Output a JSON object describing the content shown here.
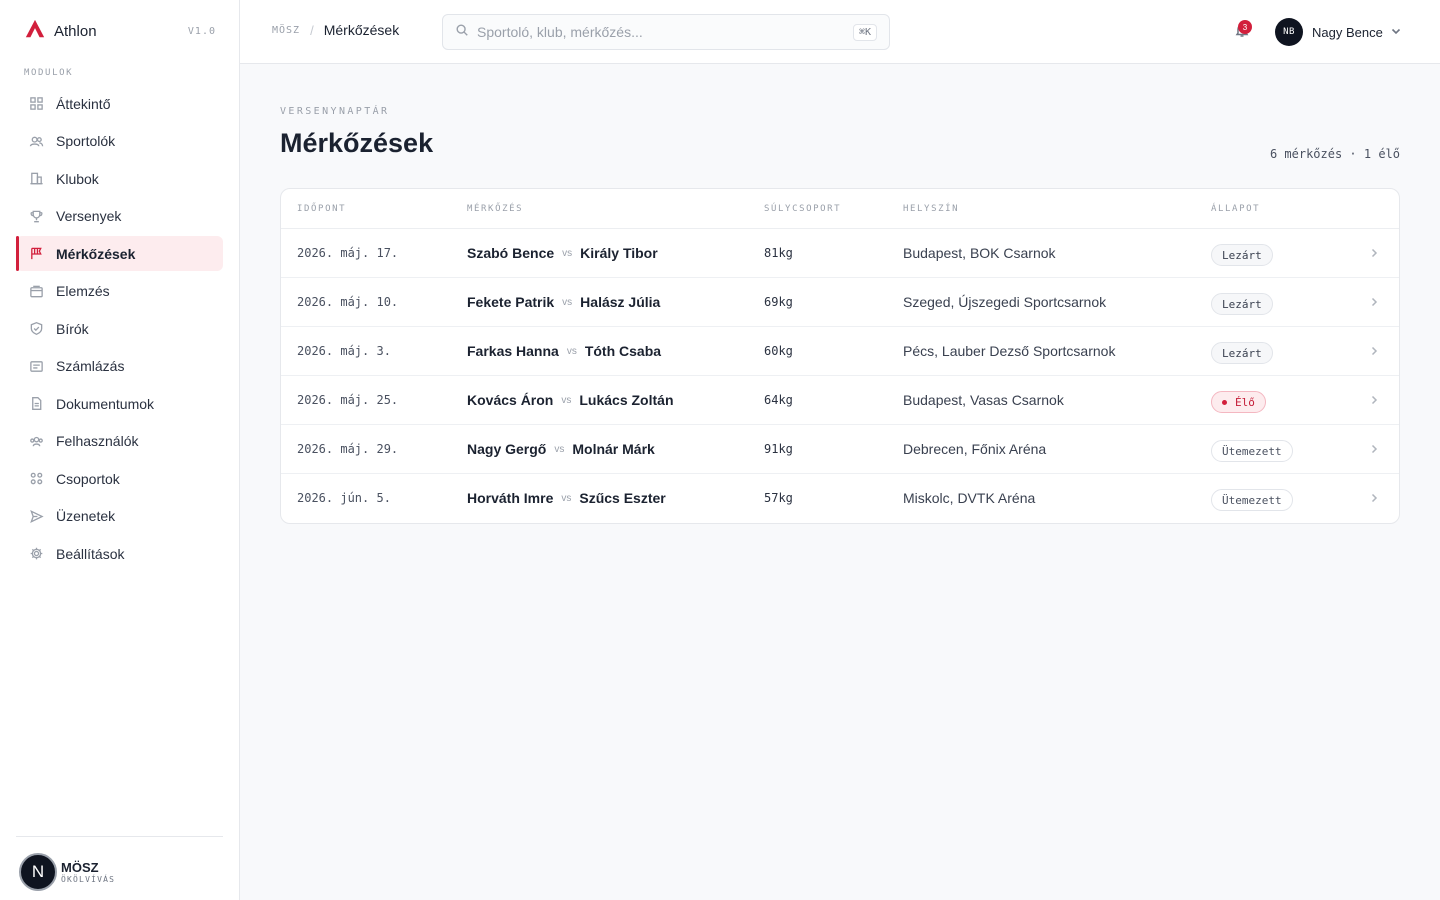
{
  "brand": {
    "name": "Athlon",
    "version": "V1.0"
  },
  "sidebar": {
    "section_label": "MODULOK",
    "items": [
      {
        "label": "Áttekintő",
        "icon": "grid-icon"
      },
      {
        "label": "Sportolók",
        "icon": "users-icon"
      },
      {
        "label": "Klubok",
        "icon": "building-icon"
      },
      {
        "label": "Versenyek",
        "icon": "trophy-icon"
      },
      {
        "label": "Mérkőzések",
        "icon": "flag-icon",
        "active": true
      },
      {
        "label": "Elemzés",
        "icon": "chart-icon"
      },
      {
        "label": "Bírók",
        "icon": "shield-icon"
      },
      {
        "label": "Számlázás",
        "icon": "invoice-icon"
      },
      {
        "label": "Dokumentumok",
        "icon": "document-icon"
      },
      {
        "label": "Felhasználók",
        "icon": "user-group-icon"
      },
      {
        "label": "Csoportok",
        "icon": "groups-icon"
      },
      {
        "label": "Üzenetek",
        "icon": "send-icon"
      },
      {
        "label": "Beállítások",
        "icon": "gear-icon"
      }
    ],
    "org": {
      "avatar_letter": "N",
      "name": "MÖSZ",
      "subtitle": "ÖKÖLVÍVÁS"
    }
  },
  "header": {
    "breadcrumb_root": "MÖSZ",
    "breadcrumb_sep": "/",
    "breadcrumb_current": "Mérkőzések",
    "search_placeholder": "Sportoló, klub, mérkőzés...",
    "search_shortcut": "⌘K",
    "notification_count": "3",
    "user_initials": "NB",
    "user_name": "Nagy Bence"
  },
  "page": {
    "eyebrow": "VERSENYNAPTÁR",
    "title": "Mérkőzések",
    "summary": "6 mérkőzés · 1 élő"
  },
  "table": {
    "columns": [
      "IDŐPONT",
      "MÉRKŐZÉS",
      "SÚLYCSOPORT",
      "HELYSZÍN",
      "ÁLLAPOT"
    ],
    "vs_label": "vs",
    "rows": [
      {
        "date": "2026. máj. 17.",
        "home": "Szabó Bence",
        "away": "Király Tibor",
        "weight": "81kg",
        "venue": "Budapest, BOK Csarnok",
        "status": "Lezárt",
        "status_type": "closed"
      },
      {
        "date": "2026. máj. 10.",
        "home": "Fekete Patrik",
        "away": "Halász Júlia",
        "weight": "69kg",
        "venue": "Szeged, Újszegedi Sportcsarnok",
        "status": "Lezárt",
        "status_type": "closed"
      },
      {
        "date": "2026. máj. 3.",
        "home": "Farkas Hanna",
        "away": "Tóth Csaba",
        "weight": "60kg",
        "venue": "Pécs, Lauber Dezső Sportcsarnok",
        "status": "Lezárt",
        "status_type": "closed"
      },
      {
        "date": "2026. máj. 25.",
        "home": "Kovács Áron",
        "away": "Lukács Zoltán",
        "weight": "64kg",
        "venue": "Budapest, Vasas Csarnok",
        "status": "Élő",
        "status_type": "live"
      },
      {
        "date": "2026. máj. 29.",
        "home": "Nagy Gergő",
        "away": "Molnár Márk",
        "weight": "91kg",
        "venue": "Debrecen, Főnix Aréna",
        "status": "Ütemezett",
        "status_type": "scheduled"
      },
      {
        "date": "2026. jún. 5.",
        "home": "Horváth Imre",
        "away": "Szűcs Eszter",
        "weight": "57kg",
        "venue": "Miskolc, DVTK Aréna",
        "status": "Ütemezett",
        "status_type": "scheduled"
      }
    ]
  },
  "colors": {
    "accent": "#d21f3c",
    "text": "#1b2230",
    "muted": "#9aa0aa",
    "active_bg": "#fdecee"
  }
}
